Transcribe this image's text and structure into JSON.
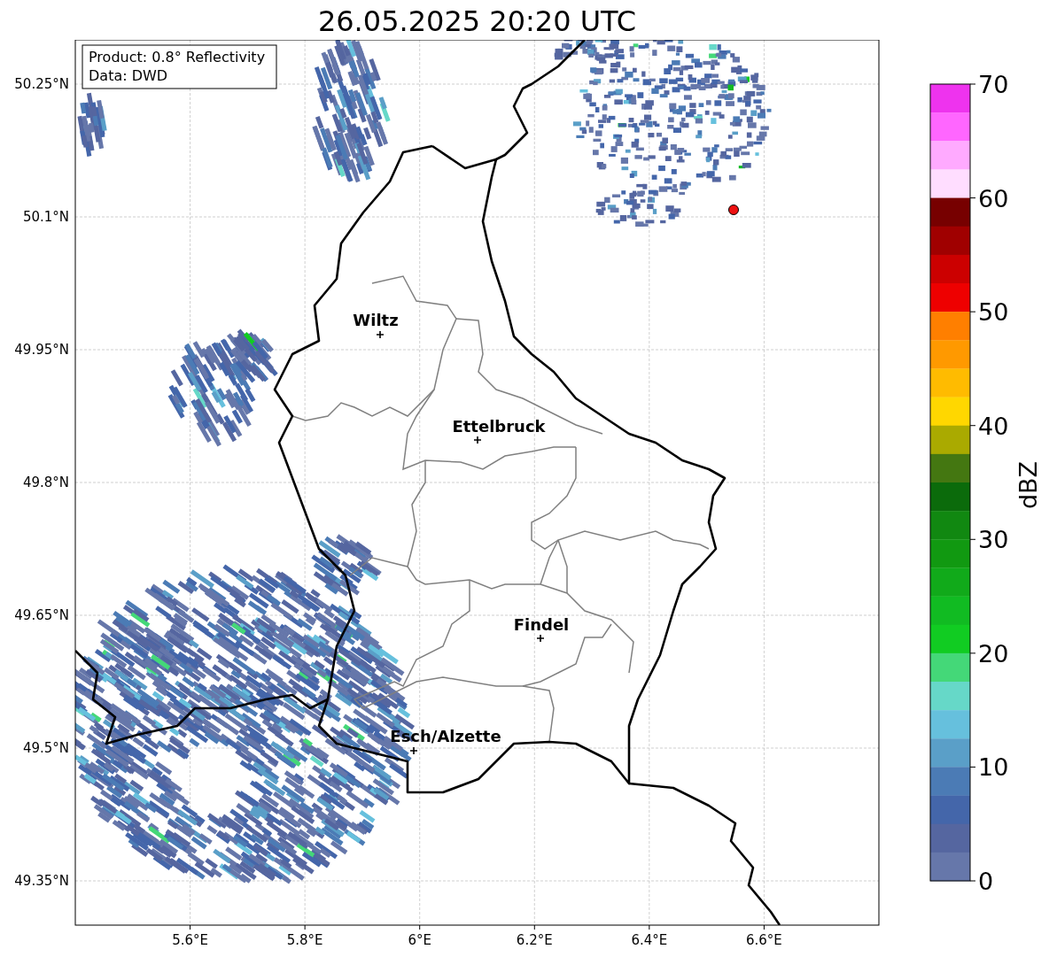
{
  "title": "26.05.2025 20:20 UTC",
  "info_box": [
    "Product: 0.8° Reflectivity",
    "Data: DWD"
  ],
  "map": {
    "longitude_labels": [
      "5.6°E",
      "5.8°E",
      "6°E",
      "6.2°E",
      "6.4°E",
      "6.6°E"
    ],
    "latitude_labels": [
      "50.25°N",
      "50.1°N",
      "49.95°N",
      "49.8°N",
      "49.65°N",
      "49.5°N",
      "49.35°N"
    ],
    "cities": [
      {
        "label": "Wiltz"
      },
      {
        "label": "Ettelbruck"
      },
      {
        "label": "Findel"
      },
      {
        "label": "Esch/Alzette"
      }
    ]
  },
  "colorbar": {
    "label": "dBZ",
    "ticks": [
      "70",
      "60",
      "50",
      "40",
      "30",
      "20",
      "10",
      "0"
    ],
    "bands": [
      {
        "color": "#ee33ee"
      },
      {
        "color": "#ff66ff"
      },
      {
        "color": "#ffaaff"
      },
      {
        "color": "#ffddff"
      },
      {
        "color": "#770000"
      },
      {
        "color": "#a00000"
      },
      {
        "color": "#cc0000"
      },
      {
        "color": "#ee0000"
      },
      {
        "color": "#ff7f00"
      },
      {
        "color": "#ff9900"
      },
      {
        "color": "#ffbb00"
      },
      {
        "color": "#ffd700"
      },
      {
        "color": "#aaaa00"
      },
      {
        "color": "#447711"
      },
      {
        "color": "#0b6b0b"
      },
      {
        "color": "#118811"
      },
      {
        "color": "#119911"
      },
      {
        "color": "#11aa1a"
      },
      {
        "color": "#11bb22"
      },
      {
        "color": "#11cc22"
      },
      {
        "color": "#44d878"
      },
      {
        "color": "#66d8c8"
      },
      {
        "color": "#66c0dd"
      },
      {
        "color": "#5a9fc8"
      },
      {
        "color": "#4b7bb5"
      },
      {
        "color": "#4466aa"
      },
      {
        "color": "#5566a0"
      },
      {
        "color": "#6677aa"
      }
    ]
  }
}
